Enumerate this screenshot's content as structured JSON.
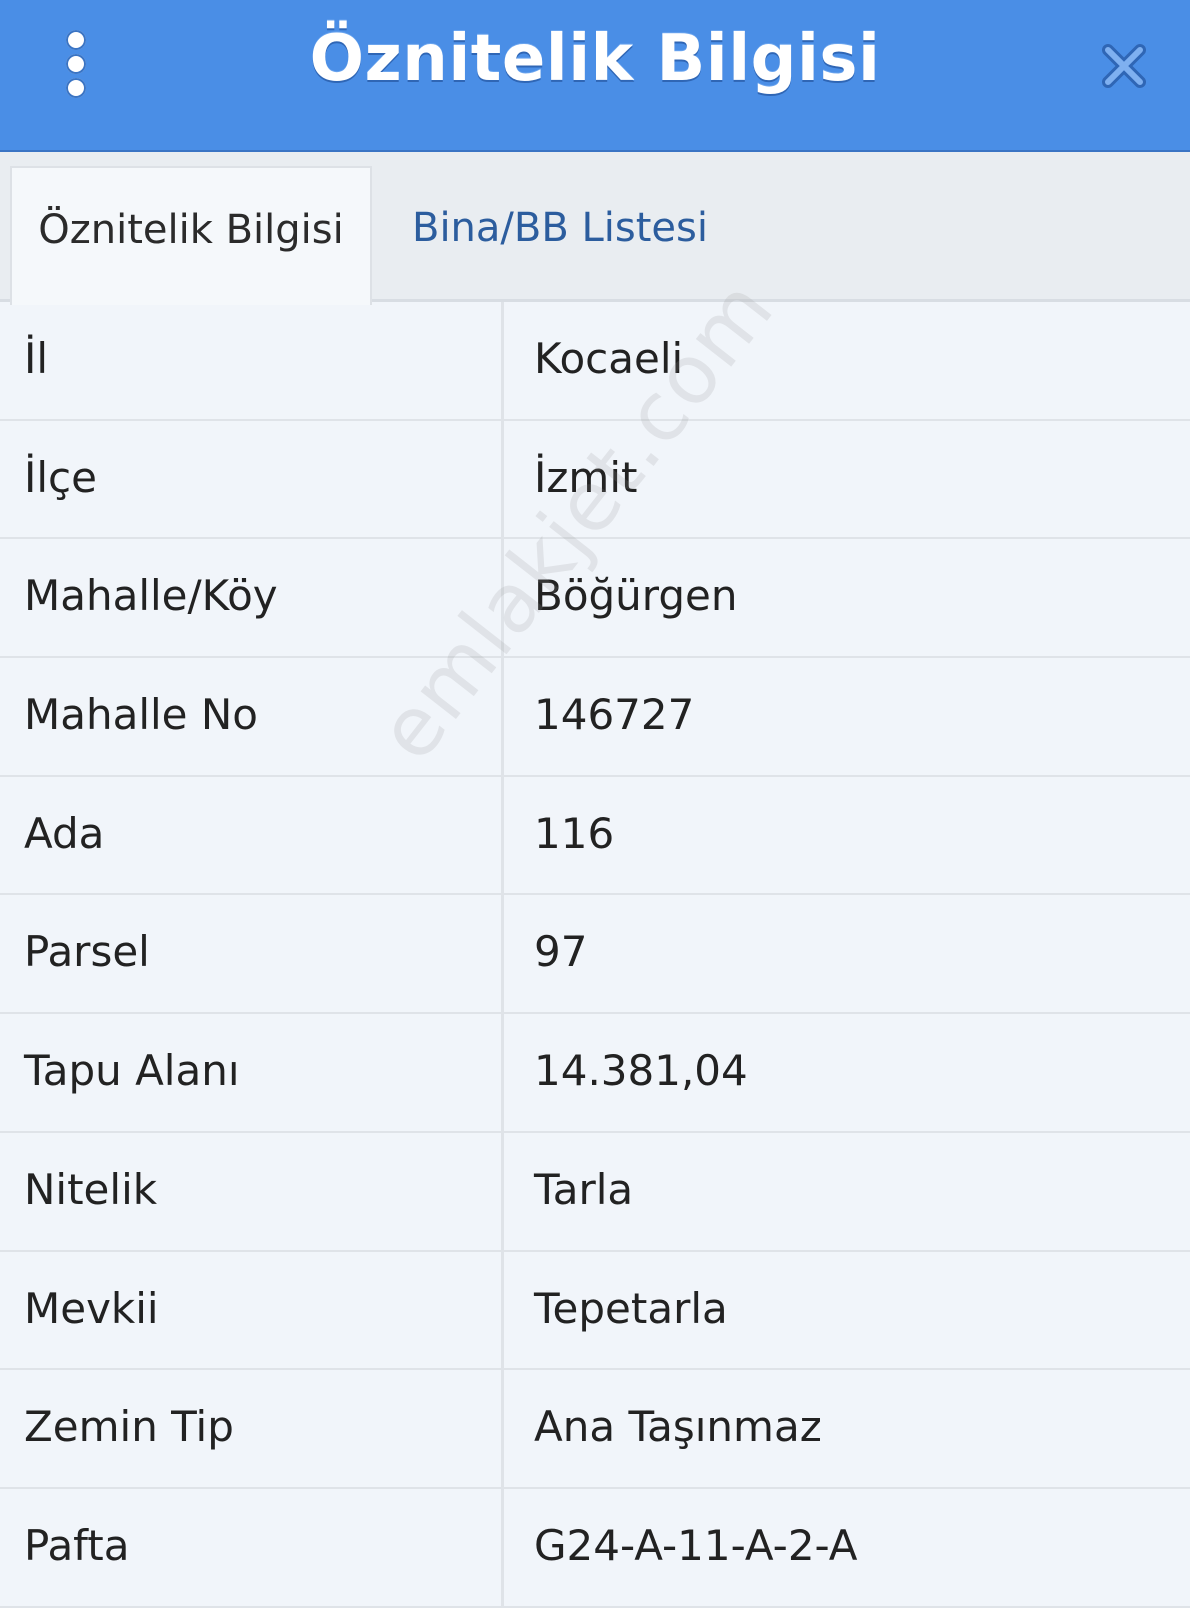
{
  "header": {
    "title": "Öznitelik Bilgisi"
  },
  "tabs": [
    {
      "label": "Öznitelik Bilgisi",
      "active": true
    },
    {
      "label": "Bina/BB Listesi",
      "active": false
    }
  ],
  "rows": [
    {
      "key": "İl",
      "value": "Kocaeli"
    },
    {
      "key": "İlçe",
      "value": "İzmit"
    },
    {
      "key": "Mahalle/Köy",
      "value": "Böğürgen"
    },
    {
      "key": "Mahalle No",
      "value": "146727"
    },
    {
      "key": "Ada",
      "value": "116"
    },
    {
      "key": "Parsel",
      "value": "97"
    },
    {
      "key": "Tapu Alanı",
      "value": "14.381,04"
    },
    {
      "key": "Nitelik",
      "value": "Tarla"
    },
    {
      "key": "Mevkii",
      "value": "Tepetarla"
    },
    {
      "key": "Zemin Tip",
      "value": "Ana Taşınmaz"
    },
    {
      "key": "Pafta",
      "value": "G24-A-11-A-2-A"
    }
  ],
  "watermark": "emlakjet.com",
  "colors": {
    "header_bg": "#4a8ee6",
    "tab_inactive_text": "#2c5d9e",
    "row_bg": "#f1f5fa"
  },
  "icons": {
    "menu": "vertical-dots-icon",
    "close": "close-icon"
  }
}
